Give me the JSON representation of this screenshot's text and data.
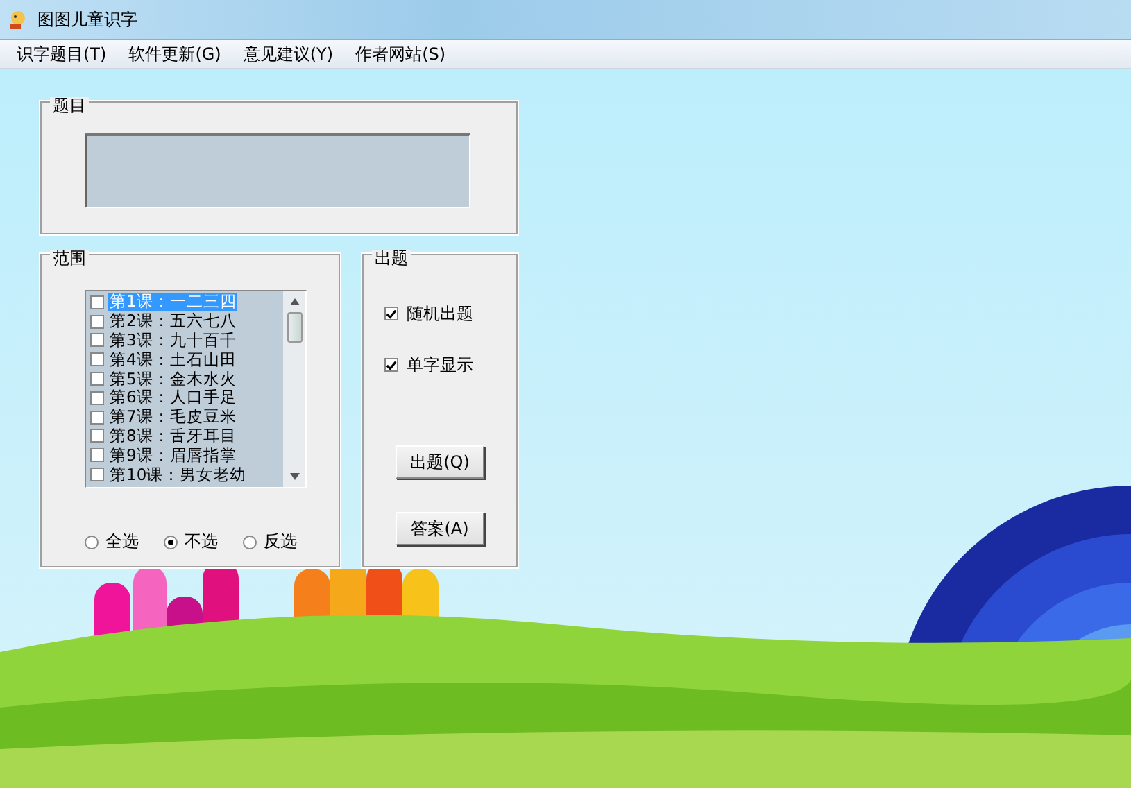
{
  "window": {
    "title": "图图儿童识字"
  },
  "menu": [
    "识字题目(T)",
    "软件更新(G)",
    "意见建议(Y)",
    "作者网站(S)"
  ],
  "question_group": {
    "label": "题目"
  },
  "range_group": {
    "label": "范围",
    "lessons": [
      {
        "label": "第1课：一二三四",
        "checked": false,
        "selected": true
      },
      {
        "label": "第2课：五六七八",
        "checked": false,
        "selected": false
      },
      {
        "label": "第3课：九十百千",
        "checked": false,
        "selected": false
      },
      {
        "label": "第4课：土石山田",
        "checked": false,
        "selected": false
      },
      {
        "label": "第5课：金木水火",
        "checked": false,
        "selected": false
      },
      {
        "label": "第6课：人口手足",
        "checked": false,
        "selected": false
      },
      {
        "label": "第7课：毛皮豆米",
        "checked": false,
        "selected": false
      },
      {
        "label": "第8课：舌牙耳目",
        "checked": false,
        "selected": false
      },
      {
        "label": "第9课：眉唇指掌",
        "checked": false,
        "selected": false
      },
      {
        "label": "第10课：男女老幼",
        "checked": false,
        "selected": false
      }
    ],
    "options": [
      {
        "label": "全选",
        "selected": false
      },
      {
        "label": "不选",
        "selected": true
      },
      {
        "label": "反选",
        "selected": false
      }
    ]
  },
  "quiz_group": {
    "label": "出题",
    "settings": [
      {
        "label": "随机出题",
        "checked": true
      },
      {
        "label": "单字显示",
        "checked": true
      }
    ],
    "buttons": [
      "出题(Q)",
      "答案(A)"
    ]
  }
}
